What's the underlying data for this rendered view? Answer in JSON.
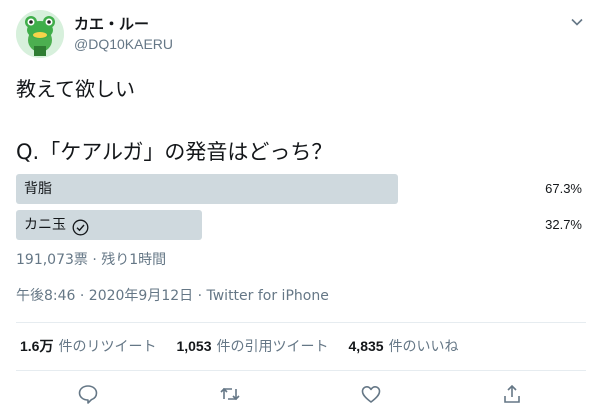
{
  "user": {
    "display_name": "カエ・ルー",
    "handle": "@DQ10KAERU"
  },
  "tweet": {
    "text": "教えて欲しい",
    "question": "Q.「ケアルガ」の発音はどっち？"
  },
  "poll": {
    "options": [
      {
        "label": "背脂",
        "percent_text": "67.3%",
        "fraction": 0.673,
        "winner": false
      },
      {
        "label": "カニ玉",
        "percent_text": "32.7%",
        "fraction": 0.327,
        "winner": true
      }
    ],
    "meta": "191,073票 · 残り1時間",
    "bar_color": "#cfd9de"
  },
  "timestamp": "午後8:46 · 2020年9月12日 · Twitter for iPhone",
  "stats": {
    "retweets_num": "1.6万",
    "retweets_label": "件のリツイート",
    "quotes_num": "1,053",
    "quotes_label": "件の引用ツイート",
    "likes_num": "4,835",
    "likes_label": "件のいいね"
  },
  "icons": {
    "reply": "reply-icon",
    "retweet": "retweet-icon",
    "like": "heart-icon",
    "share": "share-icon",
    "caret": "chevron-down-icon",
    "check": "check-circle-icon"
  },
  "colors": {
    "text": "#14171a",
    "secondary": "#657786",
    "divider": "#e6ecf0"
  }
}
